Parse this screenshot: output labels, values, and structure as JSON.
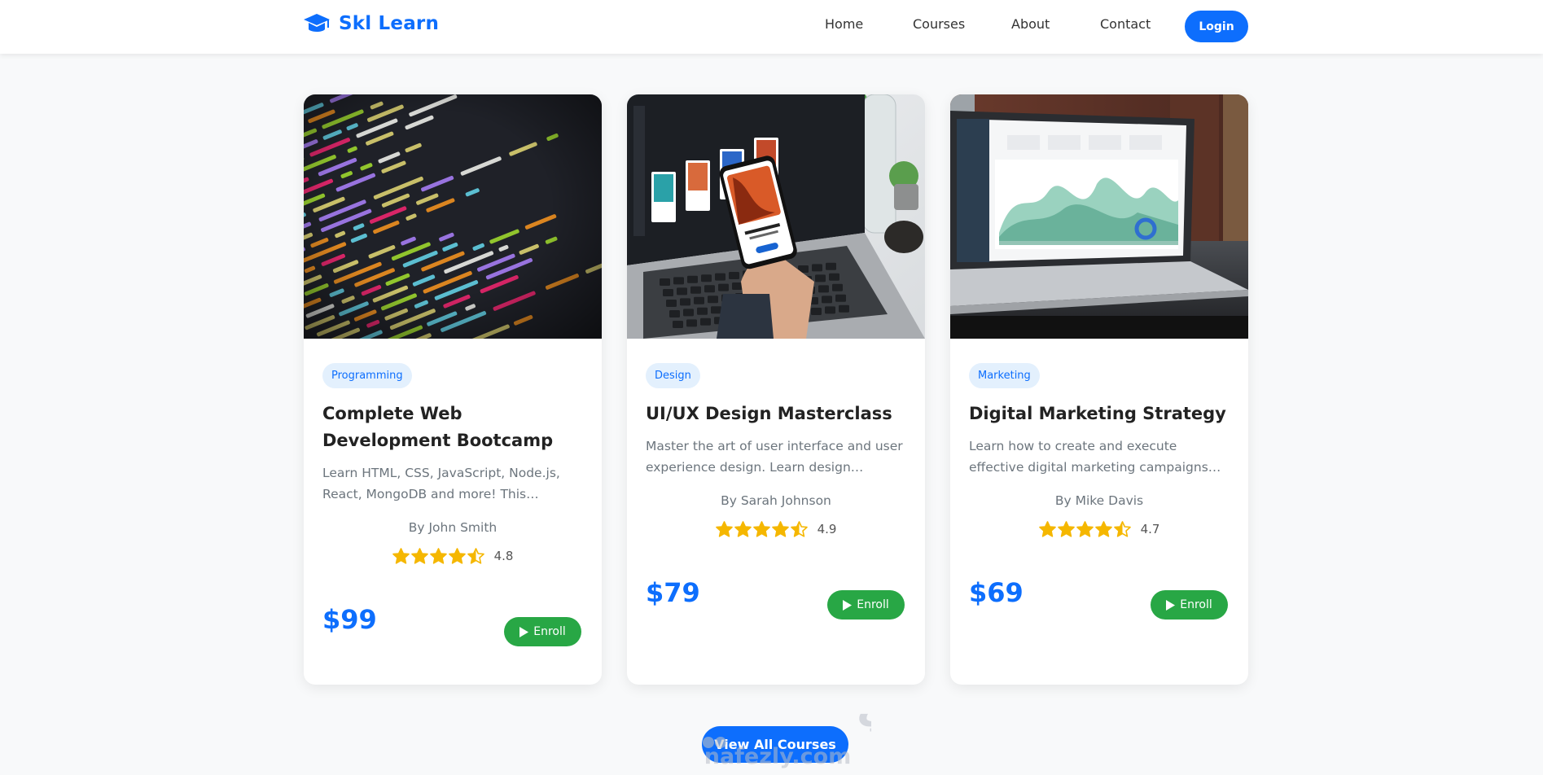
{
  "header": {
    "brand": "Skl Learn",
    "nav": [
      "Home",
      "Courses",
      "About",
      "Contact"
    ],
    "login_label": "Login"
  },
  "courses": [
    {
      "category": "Programming",
      "title": "Complete Web Development Bootcamp",
      "description": "Learn HTML, CSS, JavaScript, Node.js, React, MongoDB and more! This comprehensive course covers everything you need.",
      "author": "By John Smith",
      "rating": "4.8",
      "rating_stars": 4.5,
      "price": "$99",
      "enroll_label": "Enroll",
      "image_icon": "code-editor-image"
    },
    {
      "category": "Design",
      "title": "UI/UX Design Masterclass",
      "description": "Master the art of user interface and user experience design. Learn design principles, tools and workflows.",
      "author": "By Sarah Johnson",
      "rating": "4.9",
      "rating_stars": 4.5,
      "price": "$79",
      "enroll_label": "Enroll",
      "image_icon": "design-laptop-image"
    },
    {
      "category": "Marketing",
      "title": "Digital Marketing Strategy",
      "description": "Learn how to create and execute effective digital marketing campaigns across multiple platforms.",
      "author": "By Mike Davis",
      "rating": "4.7",
      "rating_stars": 4.5,
      "price": "$69",
      "enroll_label": "Enroll",
      "image_icon": "analytics-laptop-image"
    }
  ],
  "view_all_label": "View All Courses",
  "watermark": {
    "arabic": "نفذلي",
    "latin": "nafezly.com"
  },
  "colors": {
    "primary": "#0d6efd",
    "success": "#28a745",
    "star": "#f5b700",
    "badge_bg": "#e3f0fd"
  }
}
